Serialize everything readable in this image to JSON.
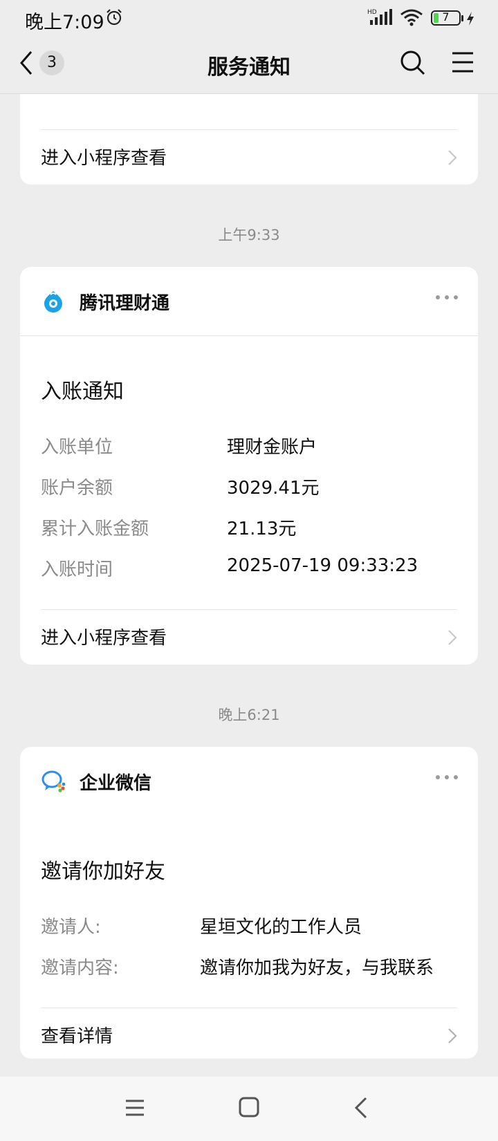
{
  "status_bar": {
    "time": "晚上7:09",
    "battery": "7",
    "network": "HD"
  },
  "nav": {
    "badge": "3",
    "title": "服务通知"
  },
  "top_card": {
    "partial_text": "…",
    "footer_link": "进入小程序查看"
  },
  "divider_1": "上午9:33",
  "finance_card": {
    "app_name": "腾讯理财通",
    "title": "入账通知",
    "fields": [
      {
        "label": "入账单位",
        "value": "理财金账户"
      },
      {
        "label": "账户余额",
        "value": "3029.41元"
      },
      {
        "label": "累计入账金额",
        "value": "21.13元"
      },
      {
        "label": "入账时间",
        "value": "2025-07-19 09:33:23"
      }
    ],
    "footer_link": "进入小程序查看",
    "logo_color": "#1aa3e8"
  },
  "divider_2": "晚上6:21",
  "wework_card": {
    "app_name": "企业微信",
    "title": "邀请你加好友",
    "fields": [
      {
        "label": "邀请人:",
        "value": "星垣文化的工作人员"
      },
      {
        "label": "邀请内容:",
        "value": "邀请你加我为好友，与我联系"
      }
    ],
    "footer_link": "查看详情"
  }
}
